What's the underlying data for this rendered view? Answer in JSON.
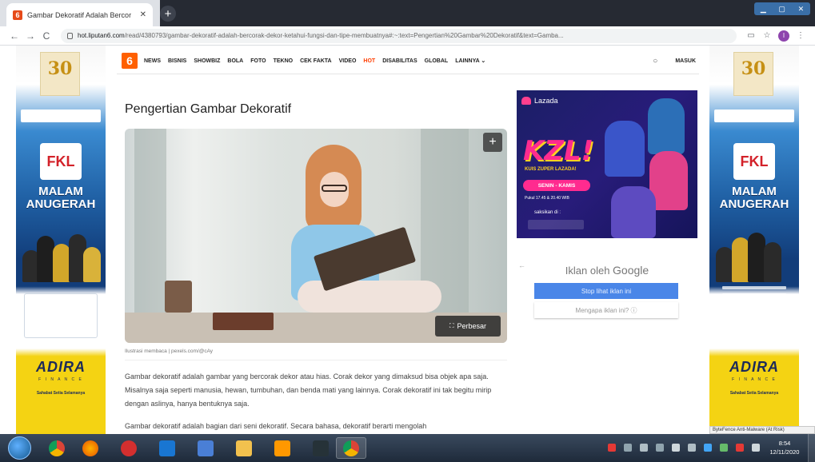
{
  "browser": {
    "tab_title": "Gambar Dekoratif Adalah Bercor",
    "tab_close": "✕",
    "new_tab": "+",
    "url_host": "hot.liputan6.com",
    "url_path": "/read/4380793/gambar-dekoratif-adalah-bercorak-dekor-ketahui-fungsi-dan-tipe-membuatnya#:~:text=Pengertian%20Gambar%20Dekoratif&text=Gamba...",
    "back": "←",
    "forward": "→",
    "reload": "C",
    "profile_initial": "I"
  },
  "site_nav": {
    "logo": "6",
    "items": [
      "NEWS",
      "BISNIS",
      "SHOWBIZ",
      "BOLA",
      "FOTO",
      "TEKNO",
      "CEK FAKTA",
      "VIDEO",
      "HOT",
      "DISABILITAS",
      "GLOBAL",
      "LAINNYA ⌄"
    ],
    "login": "MASUK"
  },
  "article": {
    "title": "Pengertian Gambar Dekoratif",
    "zoom_label": "Perbesar",
    "caption": "Ilustrasi membaca | pexels.com/@cAy",
    "paragraph1": "Gambar dekoratif adalah gambar yang bercorak dekor atau hias. Corak dekor yang dimaksud bisa objek apa saja. Misalnya saja seperti manusia, hewan, tumbuhan, dan benda mati yang lainnya. Corak dekoratif ini tak begitu mirip dengan aslinya, hanya bentuknya saja.",
    "paragraph2": "Gambar dekoratif adalah bagian dari seni dekoratif. Secara bahasa, dekoratif berarti mengolah"
  },
  "side_banner": {
    "anniversary": "30",
    "fkl": "FKL",
    "malam": "MALAM",
    "anugerah": "ANUGERAH",
    "adira": "ADIRA",
    "finance": "F I N A N C E",
    "sahabat": "Sahabat Setia Selamanya"
  },
  "lazada_ad": {
    "brand": "Lazada",
    "headline": "KZL!",
    "sub": "KUIS ZUPER LAZADA!",
    "days": "SENIN - KAMIS",
    "time": "Pukul 17.45 & 20.40 WIB",
    "watch": "saksikan di :"
  },
  "google_ad": {
    "title_prefix": "Iklan oleh ",
    "title_brand": "Google",
    "stop_label": "Stop lihat iklan ini",
    "why_label": "Mengapa iklan ini? ⓘ",
    "back_arrow": "←"
  },
  "footer_notice": "ByteFence Anti-Malware (At Risk)",
  "taskbar": {
    "time": "8:54",
    "date": "12/11/2020"
  }
}
